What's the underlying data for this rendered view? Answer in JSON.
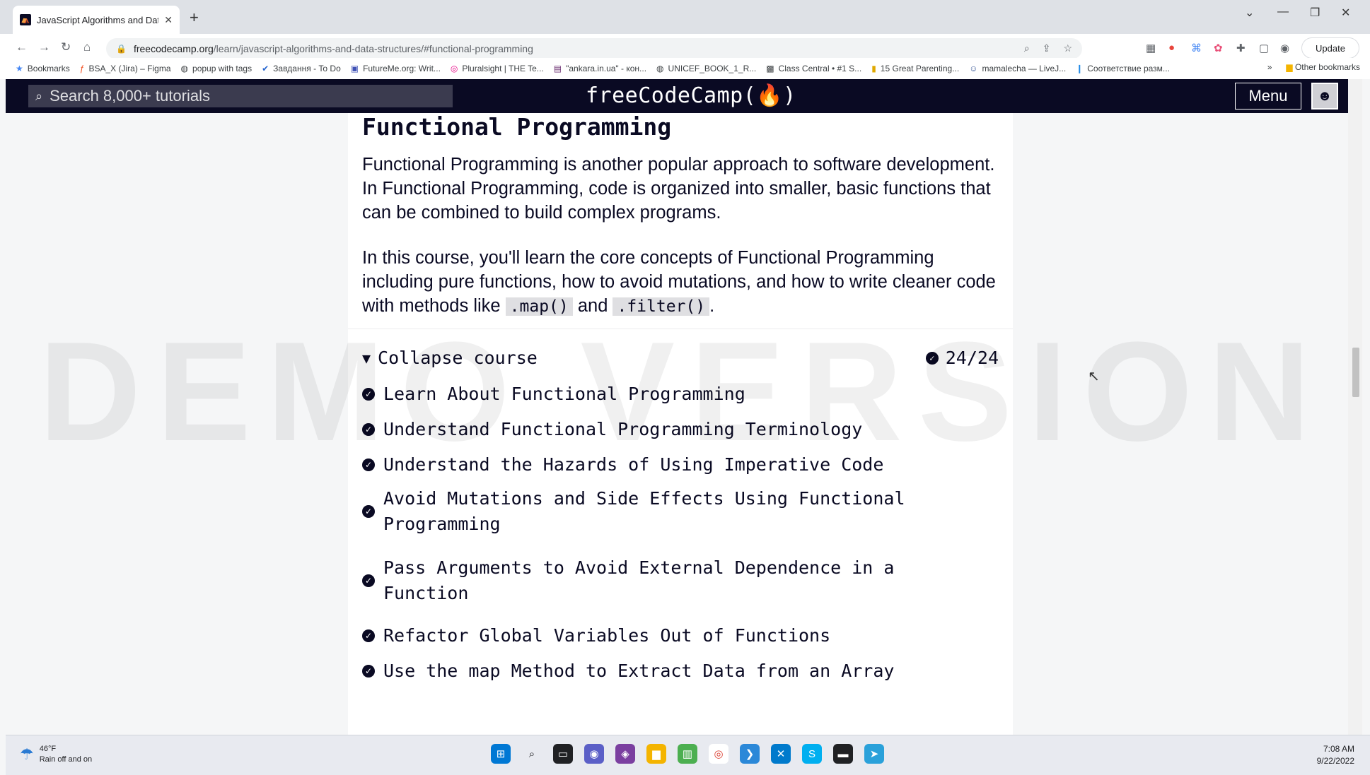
{
  "browser": {
    "tab_title": "JavaScript Algorithms and Data S",
    "url_domain": "freecodecamp.org",
    "url_path": "/learn/javascript-algorithms-and-data-structures/#functional-programming",
    "update_label": "Update",
    "bookmarks": [
      {
        "label": "Bookmarks",
        "icon": "star-icon"
      },
      {
        "label": "BSA_X (Jira) – Figma",
        "icon": "figma-icon"
      },
      {
        "label": "popup with tags",
        "icon": "globe-icon"
      },
      {
        "label": "Завдання - To Do",
        "icon": "check-icon"
      },
      {
        "label": "FutureMe.org: Writ...",
        "icon": "futureme-icon"
      },
      {
        "label": "Pluralsight | THE Te...",
        "icon": "pluralsight-icon"
      },
      {
        "label": "\"ankara.in.ua\" - кон...",
        "icon": "site-icon"
      },
      {
        "label": "UNICEF_BOOK_1_R...",
        "icon": "globe-icon"
      },
      {
        "label": "Class Central • #1 S...",
        "icon": "classcentral-icon"
      },
      {
        "label": "15 Great Parenting...",
        "icon": "site-icon"
      },
      {
        "label": "mamalecha — LiveJ...",
        "icon": "user-icon"
      },
      {
        "label": "Соответствие разм...",
        "icon": "site-icon"
      }
    ],
    "other_bookmarks": "Other bookmarks"
  },
  "fcc": {
    "search_placeholder": "Search 8,000+ tutorials",
    "logo": "freeCodeCamp(🔥)",
    "menu_label": "Menu"
  },
  "content": {
    "block_title": "Functional Programming",
    "para1": "Functional Programming is another popular approach to software development. In Functional Programming, code is organized into smaller, basic functions that can be combined to build complex programs.",
    "para2_a": "In this course, you'll learn the core concepts of Functional Programming including pure functions, how to avoid mutations, and how to write cleaner code with methods like ",
    "para2_code1": ".map()",
    "para2_b": " and ",
    "para2_code2": ".filter()",
    "para2_c": ".",
    "collapse_label": "Collapse course",
    "progress": "24/24",
    "lessons": [
      "Learn About Functional Programming",
      "Understand Functional Programming Terminology",
      "Understand the Hazards of Using Imperative Code",
      "Avoid Mutations and Side Effects Using Functional Programming",
      "Pass Arguments to Avoid External Dependence in a Function",
      "Refactor Global Variables Out of Functions",
      "Use the map Method to Extract Data from an Array"
    ],
    "watermark": "DEMO VERSION"
  },
  "taskbar": {
    "temperature": "46°F",
    "weather_desc": "Rain off and on",
    "time": "7:08 AM",
    "date": "9/22/2022"
  },
  "colors": {
    "fcc_dark": "#0a0a23",
    "fcc_search": "#3b3b4f",
    "code_bg": "#dfdfe2"
  }
}
